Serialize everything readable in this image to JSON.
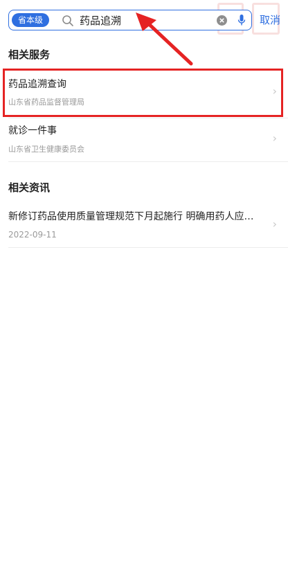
{
  "search": {
    "scope_badge": "省本级",
    "query": "药品追溯",
    "cancel_label": "取消"
  },
  "sections": {
    "services_title": "相关服务",
    "news_title": "相关资讯"
  },
  "services": [
    {
      "title": "药品追溯查询",
      "subtitle": "山东省药品监督管理局"
    },
    {
      "title": "就诊一件事",
      "subtitle": "山东省卫生健康委员会"
    }
  ],
  "news": [
    {
      "title": "新修订药品使用质量管理规范下月起施行 明确用药人应…",
      "date": "2022-09-11"
    }
  ],
  "chevron_glyph": "›",
  "colors": {
    "accent": "#2f6fe0",
    "annotation": "#e52323"
  },
  "icons": [
    "search-icon",
    "clear-icon",
    "mic-icon",
    "chevron-right-icon"
  ]
}
